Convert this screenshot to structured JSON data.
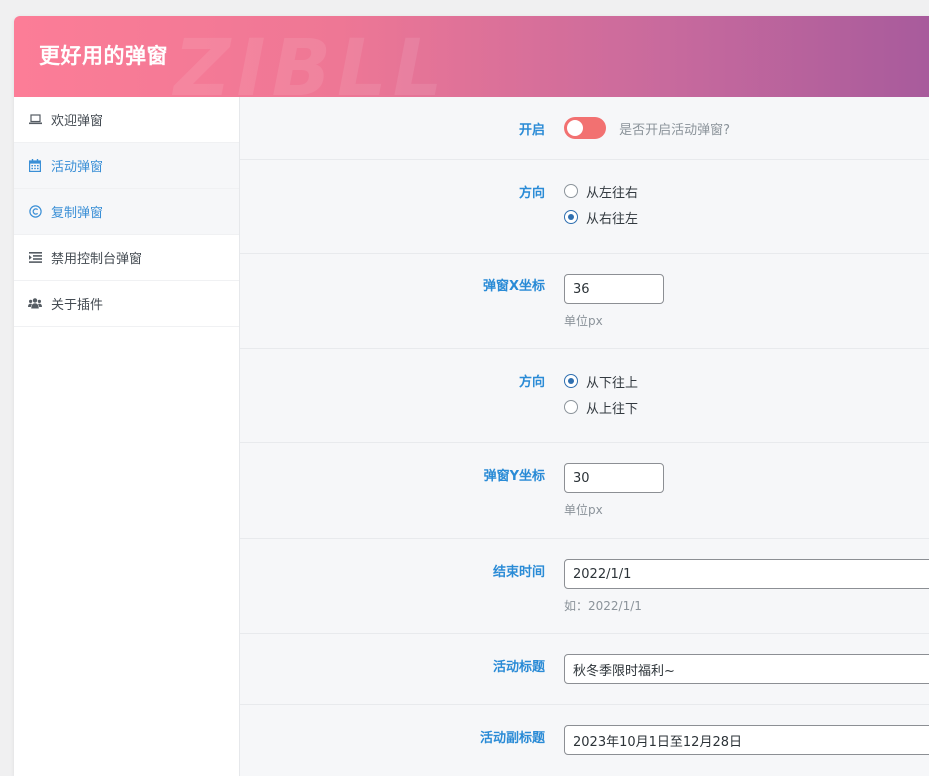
{
  "header": {
    "title": "更好用的弹窗",
    "watermark": "ZIBLL"
  },
  "sidebar": {
    "items": [
      {
        "label": "欢迎弹窗",
        "icon": "laptop-icon"
      },
      {
        "label": "活动弹窗",
        "icon": "calendar-icon"
      },
      {
        "label": "复制弹窗",
        "icon": "copyright-icon"
      },
      {
        "label": "禁用控制台弹窗",
        "icon": "indent-icon"
      },
      {
        "label": "关于插件",
        "icon": "users-icon"
      }
    ],
    "active_index": 1
  },
  "fields": {
    "enable": {
      "label": "开启",
      "hint": "是否开启活动弹窗?",
      "on": false
    },
    "direction_x": {
      "label": "方向",
      "options": [
        "从左往右",
        "从右往左"
      ],
      "selected": 1
    },
    "x_coord": {
      "label": "弹窗X坐标",
      "value": "36",
      "desc": "单位px"
    },
    "direction_y": {
      "label": "方向",
      "options": [
        "从下往上",
        "从上往下"
      ],
      "selected": 0
    },
    "y_coord": {
      "label": "弹窗Y坐标",
      "value": "30",
      "desc": "单位px"
    },
    "end_time": {
      "label": "结束时间",
      "value": "2022/1/1",
      "desc": "如：2022/1/1"
    },
    "title": {
      "label": "活动标题",
      "value": "秋冬季限时福利~"
    },
    "subtitle": {
      "label": "活动副标题",
      "value": "2023年10月1日至12月28日"
    }
  },
  "colors": {
    "accent": "#2a8bd6",
    "toggle": "#f27171",
    "header_start": "#fc7d97",
    "header_end": "#a65a9c"
  }
}
